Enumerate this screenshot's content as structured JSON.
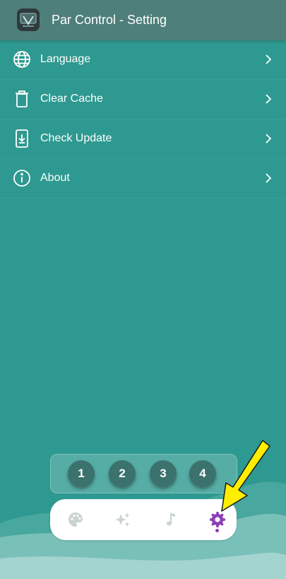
{
  "header": {
    "title": "Par Control - Setting",
    "logo_icon": "app-logo-icon",
    "background": "#4f7f7a"
  },
  "menu": {
    "items": [
      {
        "label": "Language",
        "icon": "globe-icon"
      },
      {
        "label": "Clear Cache",
        "icon": "trash-icon"
      },
      {
        "label": "Check Update",
        "icon": "phone-download-icon"
      },
      {
        "label": "About",
        "icon": "info-icon"
      }
    ]
  },
  "number_buttons": [
    "1",
    "2",
    "3",
    "4"
  ],
  "tabbar": {
    "tabs": [
      {
        "icon": "palette-icon",
        "active": false
      },
      {
        "icon": "sparkles-icon",
        "active": false
      },
      {
        "icon": "music-note-icon",
        "active": false
      },
      {
        "icon": "settings-gear-icon",
        "active": true
      }
    ],
    "active_color": "#8b3fb5",
    "inactive_color": "#c9d3d2"
  },
  "annotation": {
    "icon": "yellow-arrow-icon",
    "color": "#ffee00"
  },
  "colors": {
    "background": "#2e9990",
    "accent": "#8b3fb5"
  }
}
